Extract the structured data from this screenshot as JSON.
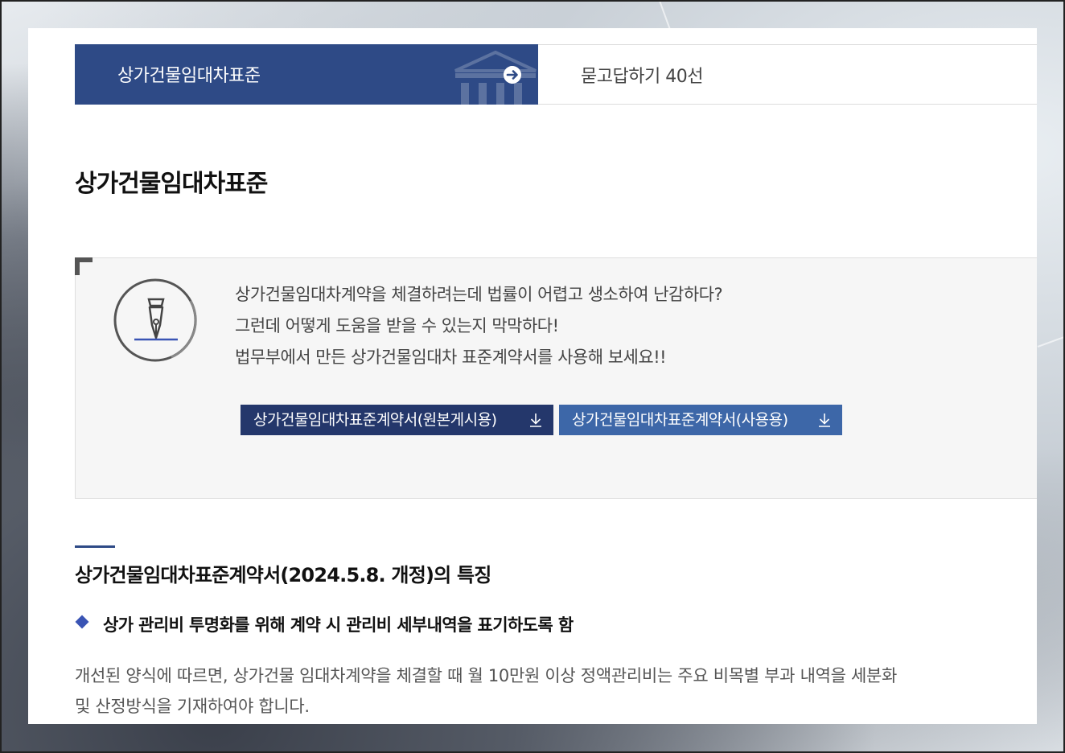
{
  "tabs": [
    {
      "label": "상가건물임대차표준",
      "active": true
    },
    {
      "label": "묻고답하기 40선",
      "active": false
    }
  ],
  "page_title": "상가건물임대차표준",
  "info": {
    "lines": [
      "상가건물임대차계약을 체결하려는데 법률이 어렵고 생소하여 난감하다?",
      "그런데 어떻게 도움을 받을 수 있는지 막막하다!",
      "법무부에서 만든 상가건물임대차 표준계약서를 사용해 보세요!!"
    ],
    "buttons": [
      {
        "label": "상가건물임대차표준계약서(원본게시용)",
        "icon": "download-icon"
      },
      {
        "label": "상가건물임대차표준계약서(사용용)",
        "icon": "download-icon"
      }
    ]
  },
  "section": {
    "title": "상가건물임대차표준계약서(2024.5.8. 개정)의 특징",
    "bullet_title": "상가 관리비 투명화를 위해 계약 시 관리비 세부내역을 표기하도록 함",
    "body_lines": [
      "개선된 양식에 따르면, 상가건물 임대차계약을 체결할 때 월 10만원 이상 정액관리비는 주요 비목별 부과 내역을 세분화",
      "및 산정방식을 기재하여야 합니다."
    ]
  },
  "colors": {
    "primary": "#2e4a86",
    "button_dark": "#24376b",
    "button_light": "#3d67a8",
    "bullet": "#3a54b4"
  }
}
